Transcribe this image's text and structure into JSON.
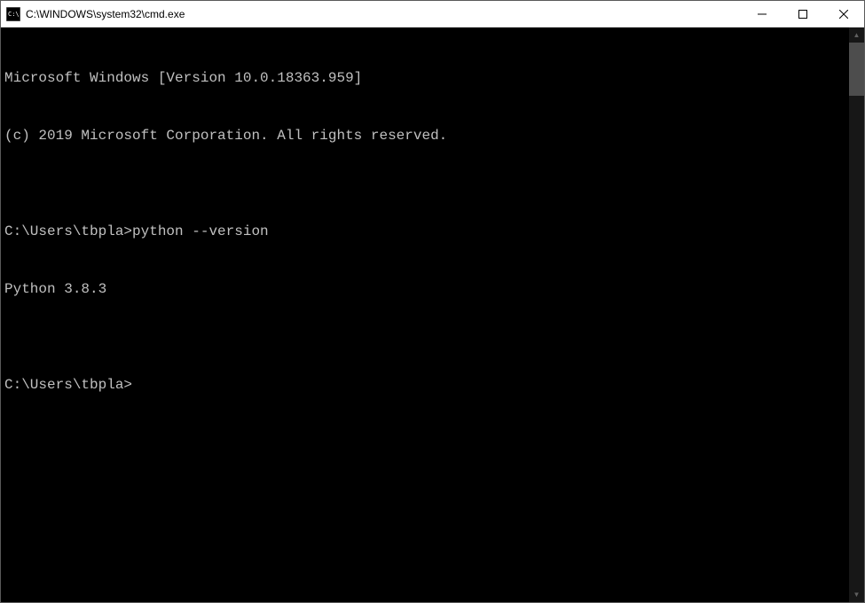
{
  "window": {
    "title": "C:\\WINDOWS\\system32\\cmd.exe"
  },
  "terminal": {
    "lines": [
      "Microsoft Windows [Version 10.0.18363.959]",
      "(c) 2019 Microsoft Corporation. All rights reserved.",
      "",
      "C:\\Users\\tbpla>python --version",
      "Python 3.8.3",
      "",
      "C:\\Users\\tbpla>"
    ]
  }
}
